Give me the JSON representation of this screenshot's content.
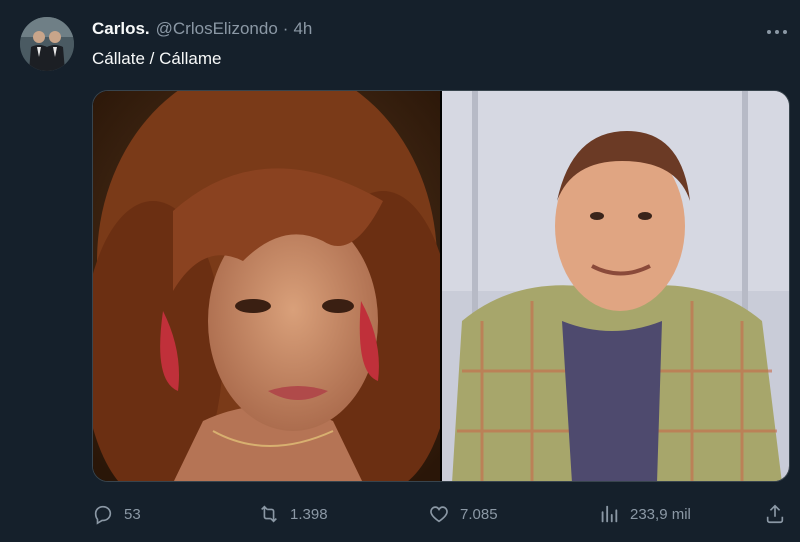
{
  "tweet": {
    "author_name": "Carlos.",
    "handle": "@CrlosElizondo",
    "separator": "·",
    "time": "4h",
    "text": "Cállate / Cállame"
  },
  "actions": {
    "replies": "53",
    "retweets": "1.398",
    "likes": "7.085",
    "views": "233,9 mil"
  },
  "icons": {
    "more": "more-icon",
    "reply": "reply-icon",
    "retweet": "retweet-icon",
    "like": "heart-icon",
    "views": "views-icon",
    "share": "share-icon"
  },
  "colors": {
    "background": "#15202b",
    "text_primary": "#f7f9f9",
    "text_secondary": "#8b98a5"
  }
}
